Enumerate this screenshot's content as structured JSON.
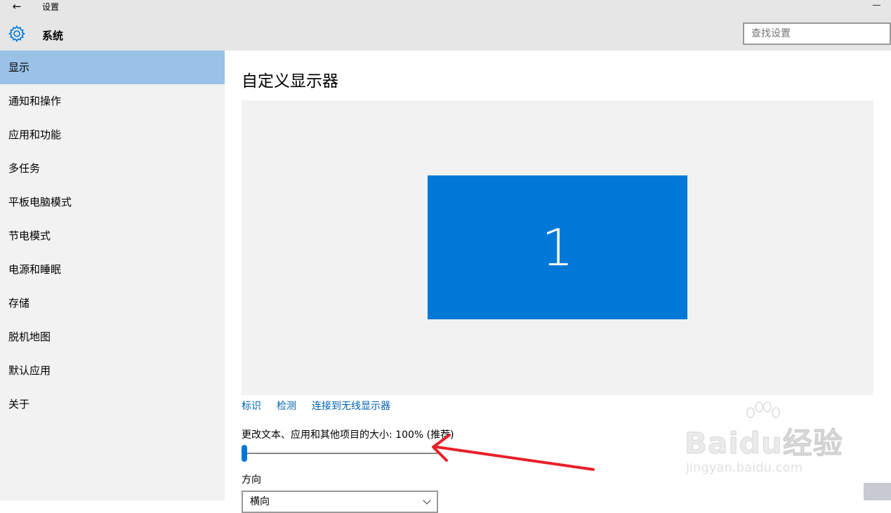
{
  "window": {
    "title": "设置"
  },
  "header": {
    "section_title": "系统",
    "search_placeholder": "查找设置"
  },
  "sidebar": {
    "items": [
      {
        "label": "显示",
        "active": true
      },
      {
        "label": "通知和操作"
      },
      {
        "label": "应用和功能"
      },
      {
        "label": "多任务"
      },
      {
        "label": "平板电脑模式"
      },
      {
        "label": "节电模式"
      },
      {
        "label": "电源和睡眠"
      },
      {
        "label": "存储"
      },
      {
        "label": "脱机地图"
      },
      {
        "label": "默认应用"
      },
      {
        "label": "关于"
      }
    ]
  },
  "main": {
    "title": "自定义显示器",
    "monitor_label": "1",
    "links": {
      "identify": "标识",
      "detect": "检测",
      "wireless": "连接到无线显示器"
    },
    "scale_label": "更改文本、应用和其他项目的大小: 100% (推荐)",
    "scale_value_percent": 100,
    "orientation_label": "方向",
    "orientation_value": "横向"
  },
  "watermark": {
    "brand": "Baidu经验",
    "url": "jingyan.baidu.com"
  },
  "colors": {
    "accent": "#0078d7",
    "selected_nav": "#99c2e6",
    "annotation_arrow": "#e8202a"
  }
}
